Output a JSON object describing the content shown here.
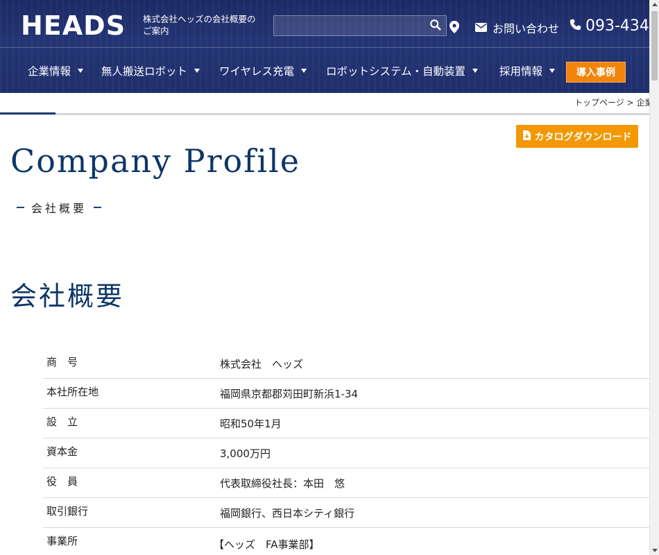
{
  "header": {
    "logo_text": "HEADS",
    "tagline": "株式会社ヘッズの会社概要のご案内",
    "search": {
      "value": "",
      "placeholder": ""
    },
    "contact_label": "お問い合わせ",
    "phone": "093-434"
  },
  "nav": {
    "items": [
      {
        "label": "企業情報"
      },
      {
        "label": "無人搬送ロボット"
      },
      {
        "label": "ワイヤレス充電"
      },
      {
        "label": "ロボットシステム・自動装置"
      },
      {
        "label": "採用情報"
      }
    ],
    "cases_label": "導入事例"
  },
  "breadcrumb": "トップページ > 企業",
  "catalog_button": "カタログダウンロード",
  "page_title": "Company Profile",
  "page_subtitle": "会社概要",
  "section_heading": "会社概要",
  "profile": [
    {
      "label": "商　号",
      "value": "株式会社　ヘッズ"
    },
    {
      "label": "本社所在地",
      "value": "福岡県京都郡苅田町新浜1-34"
    },
    {
      "label": "設　立",
      "value": "昭和50年1月"
    },
    {
      "label": "資本金",
      "value": "3,000万円"
    },
    {
      "label": "役　員",
      "value": "代表取締役社長：本田　悠"
    },
    {
      "label": "取引銀行",
      "value": "福岡銀行、西日本シティ銀行"
    },
    {
      "label": "事業所",
      "value": "【ヘッズ　FA事業部】"
    }
  ],
  "colors": {
    "header_bg": "#243575",
    "accent_orange": "#f39800",
    "title_blue": "#0d3668"
  }
}
